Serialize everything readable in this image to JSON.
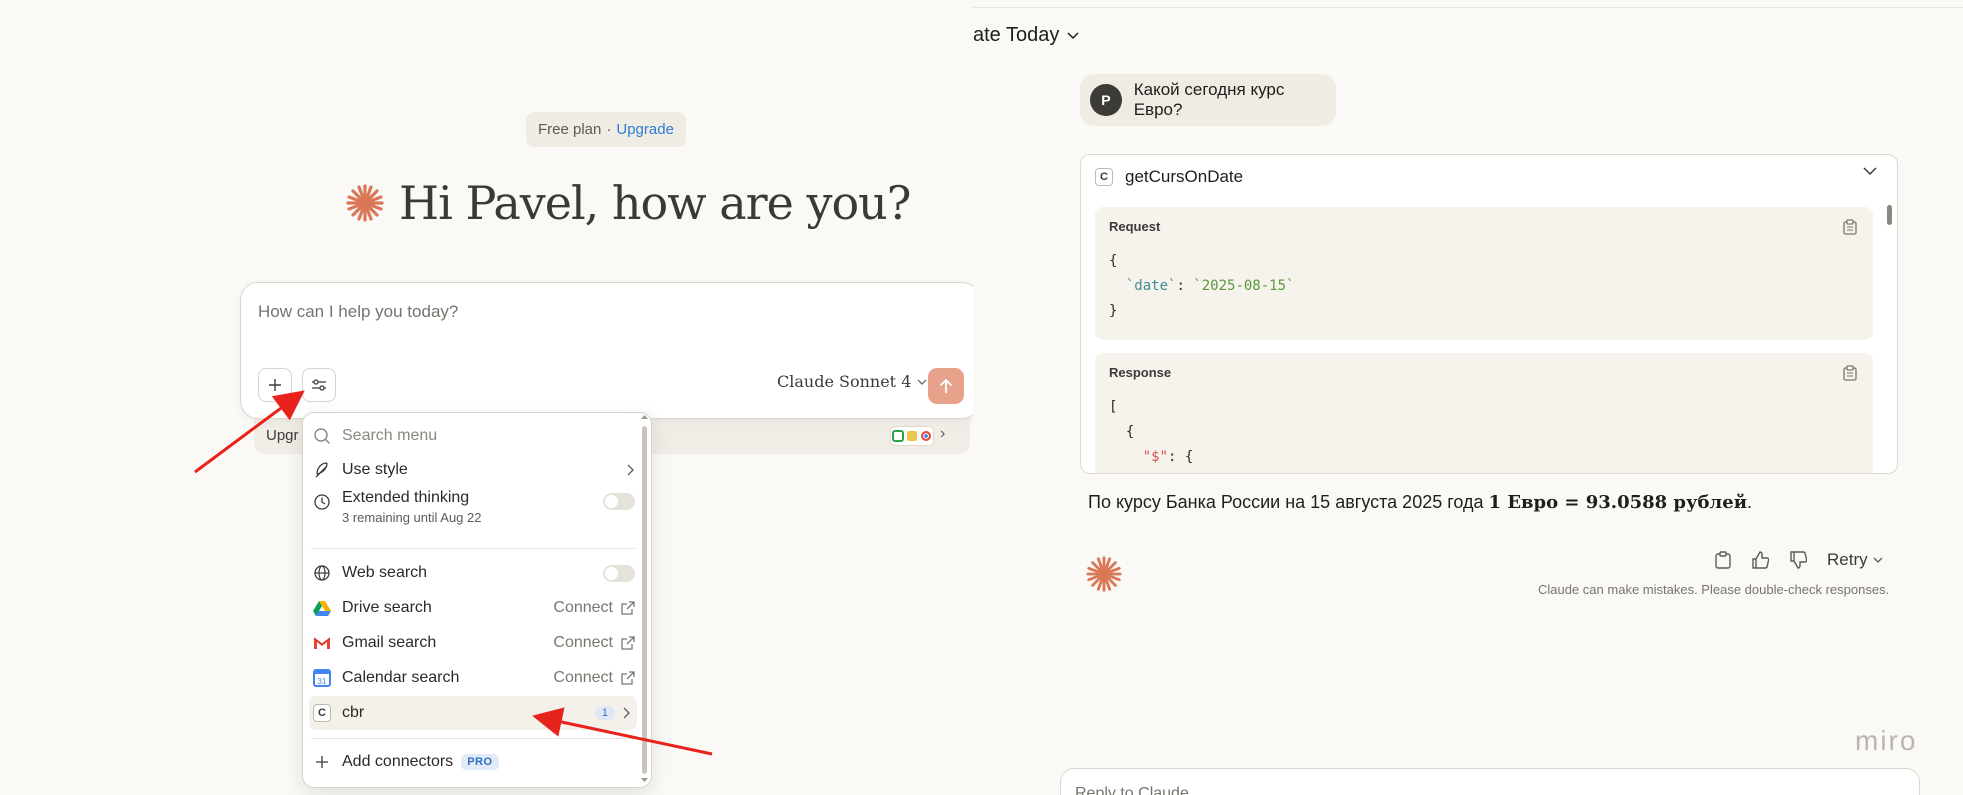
{
  "plan": {
    "label": "Free plan",
    "dot": "·",
    "upgrade": "Upgrade"
  },
  "greeting": "Hi Pavel, how are you?",
  "composer": {
    "placeholder": "How can I help you today?",
    "model": "Claude Sonnet 4"
  },
  "upgrade_strip": {
    "text": "Upgr"
  },
  "menu": {
    "search_placeholder": "Search menu",
    "use_style": "Use style",
    "extended_thinking": "Extended thinking",
    "extended_thinking_sub": "3 remaining until Aug 22",
    "web_search": "Web search",
    "drive_search": "Drive search",
    "gmail_search": "Gmail search",
    "calendar_search": "Calendar search",
    "connect": "Connect",
    "cbr": "cbr",
    "cbr_badge": "1",
    "add_connectors": "Add connectors",
    "pro": "PRO"
  },
  "chat": {
    "title": "ate Today",
    "user_initial": "P",
    "user_message": "Какой сегодня курс Евро?",
    "tool_letter": "C",
    "tool_name": "getCursOnDate",
    "request_label": "Request",
    "request_code": {
      "open": "{",
      "key": "`date`",
      "colon": ": ",
      "value": "`2025-08-15`",
      "close": "}"
    },
    "response_label": "Response",
    "response_code": {
      "l1": "[",
      "l2": "  {",
      "key": "\"$\"",
      "rest": ": {"
    },
    "answer_prefix": "По курсу Банка России на 15 августа 2025 года ",
    "answer_bold": "1 Евро = 93.0588 рублей",
    "answer_suffix": ".",
    "retry": "Retry",
    "disclaimer": "Claude can make mistakes. Please double-check responses.",
    "bottom_placeholder": "Reply to Claude..."
  },
  "watermark": "miro",
  "colors": {
    "accent": "#d97757",
    "send": "#e8a28b",
    "arrow": "#e8221c",
    "link": "#2f7bd6"
  }
}
